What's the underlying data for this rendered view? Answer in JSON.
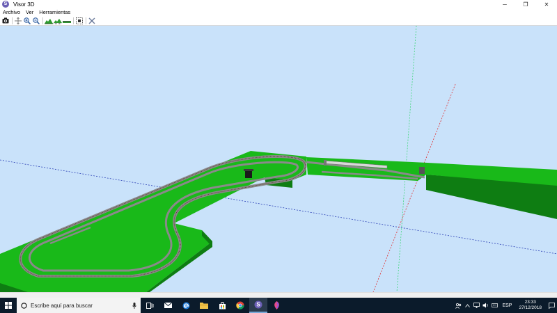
{
  "window": {
    "title": "Visor 3D",
    "minimize_label": "─",
    "maximize_label": "❐",
    "close_label": "✕"
  },
  "menu": {
    "items": [
      "Archivo",
      "Ver",
      "Herramientas"
    ]
  },
  "toolbar": {
    "buttons": [
      "camera-icon",
      "fit-view-icon",
      "zoom-in-icon",
      "zoom-out-icon",
      "terrain-icon",
      "terrain-tracks-icon",
      "tracks-icon",
      "grid-select-icon",
      "axes-icon"
    ]
  },
  "scene": {
    "background": "#c9e2fa",
    "terrain_color": "#19b919",
    "terrain_side_color": "#0e7d12",
    "track_color": "#8a8a8a"
  },
  "taskbar": {
    "search_placeholder": "Escribe aquí para buscar",
    "language": "ESP",
    "time": "23:33",
    "date": "27/12/2018"
  }
}
